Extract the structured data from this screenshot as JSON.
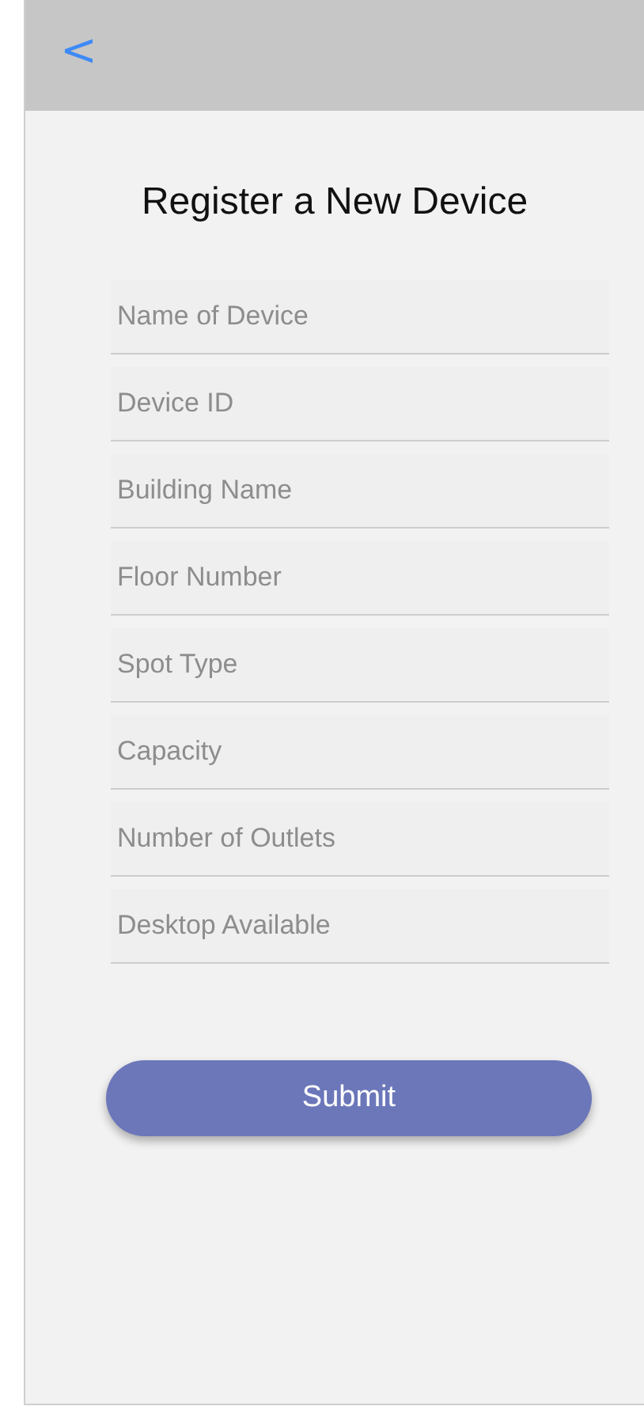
{
  "header": {
    "back": "<"
  },
  "title": "Register a New Device",
  "fields": [
    {
      "placeholder": "Name of Device"
    },
    {
      "placeholder": "Device ID"
    },
    {
      "placeholder": "Building Name"
    },
    {
      "placeholder": "Floor Number"
    },
    {
      "placeholder": "Spot Type"
    },
    {
      "placeholder": "Capacity"
    },
    {
      "placeholder": "Number of Outlets"
    },
    {
      "placeholder": "Desktop Available"
    }
  ],
  "submit": "Submit"
}
